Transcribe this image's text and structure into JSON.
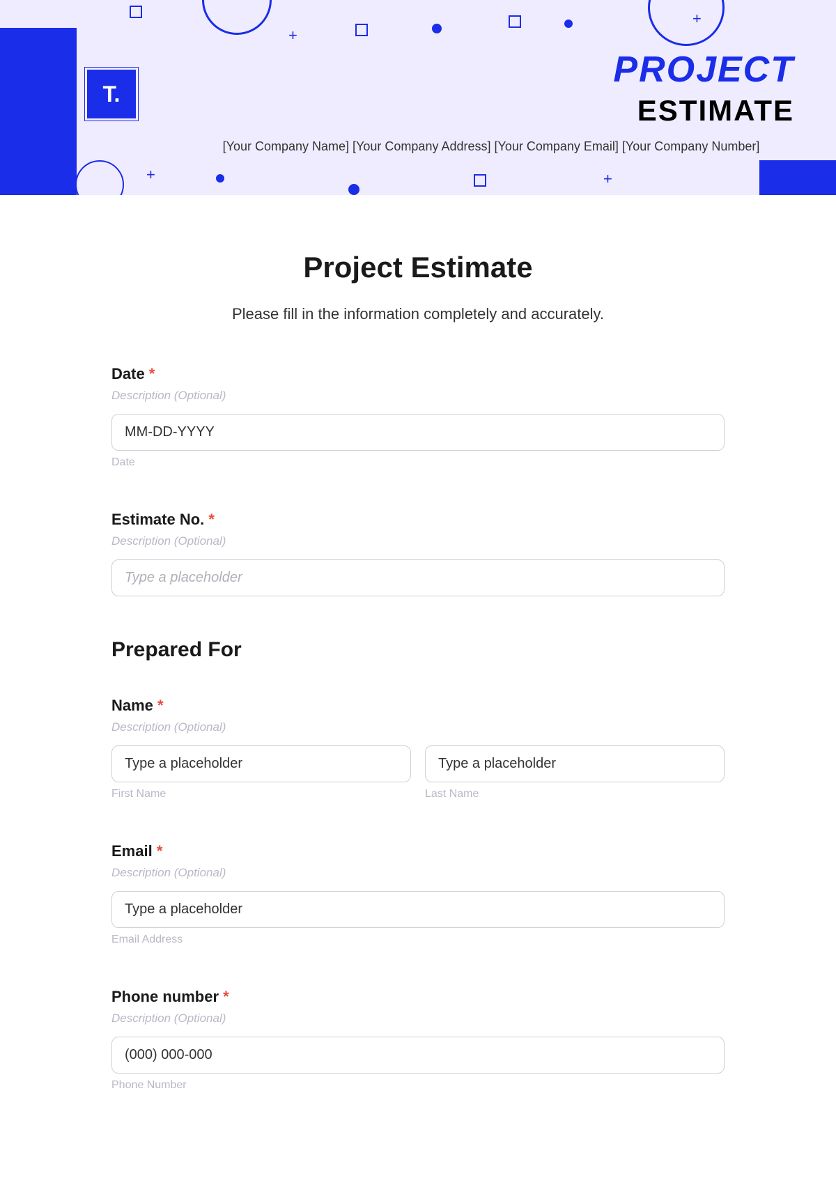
{
  "header": {
    "logo_text": "T.",
    "title_line1": "PROJECT",
    "title_line2": "ESTIMATE",
    "company_placeholders": "[Your Company Name] [Your Company Address] [Your Company Email] [Your Company Number]"
  },
  "form": {
    "title": "Project Estimate",
    "subtitle": "Please fill in the information completely and accurately.",
    "description_optional": "Description (Optional)",
    "required_marker": "*",
    "fields": {
      "date": {
        "label": "Date",
        "placeholder": "MM-DD-YYYY",
        "sublabel": "Date"
      },
      "estimate_no": {
        "label": "Estimate No.",
        "placeholder": "Type a placeholder"
      },
      "prepared_for_heading": "Prepared For",
      "name": {
        "label": "Name",
        "first_placeholder": "Type a placeholder",
        "first_sublabel": "First Name",
        "last_placeholder": "Type a placeholder",
        "last_sublabel": "Last Name"
      },
      "email": {
        "label": "Email",
        "placeholder": "Type a placeholder",
        "sublabel": "Email Address"
      },
      "phone": {
        "label": "Phone number",
        "placeholder": "(000) 000-000",
        "sublabel": "Phone Number"
      }
    }
  }
}
